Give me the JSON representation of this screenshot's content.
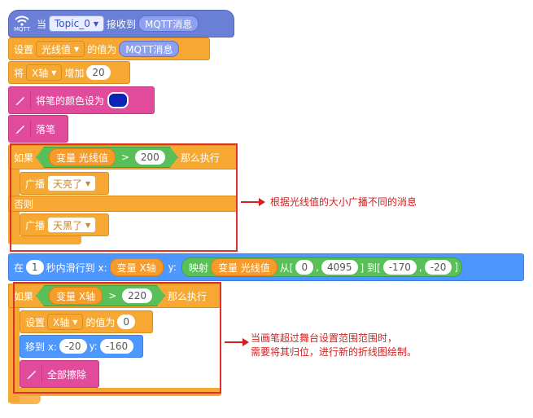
{
  "hat": {
    "icon_label": "MQTT",
    "when": "当",
    "topic": "Topic_0",
    "received": "接收到",
    "msg": "MQTT消息"
  },
  "set_light": {
    "set": "设置",
    "var": "光线值",
    "value_of": "的值为",
    "msg": "MQTT消息"
  },
  "change_x": {
    "jiang": "将",
    "axis": "X轴",
    "increase": "增加",
    "amount": "20"
  },
  "pen_color": {
    "label": "将笔的颜色设为",
    "color": "#0a24b8"
  },
  "pen_down": {
    "label": "落笔"
  },
  "if1": {
    "if": "如果",
    "var": "变量 光线值",
    "op": ">",
    "value": "200",
    "then": "那么执行",
    "bc1": "广播",
    "msg1": "天亮了",
    "else": "否则",
    "bc2": "广播",
    "msg2": "天黑了"
  },
  "note1": "根据光线值的大小广播不同的消息",
  "glide": {
    "at": "在",
    "secs": "1",
    "text1": "秒内滑行到 x:",
    "xvar": "变量 X轴",
    "y": "y:",
    "map": "映射",
    "yvar": "变量 光线值",
    "from": "从[",
    "from_lo": "0",
    "comma1": ",",
    "from_hi": "4095",
    "to": "] 到[",
    "to_lo": "-170",
    "comma2": ",",
    "to_hi": "-20",
    "close": "]"
  },
  "if2": {
    "if": "如果",
    "var": "变量 X轴",
    "op": ">",
    "value": "220",
    "then": "那么执行",
    "set": "设置",
    "axis": "X轴",
    "value_of": "的值为",
    "set_value": "0",
    "goto": "移到 x:",
    "gx": "-20",
    "gy_label": "y:",
    "gy": "-160",
    "clear": "全部擦除"
  },
  "note2_line1": "当画笔超过舞台设置范围范围时，",
  "note2_line2": "需要将其归位，进行新的折线图绘制。"
}
